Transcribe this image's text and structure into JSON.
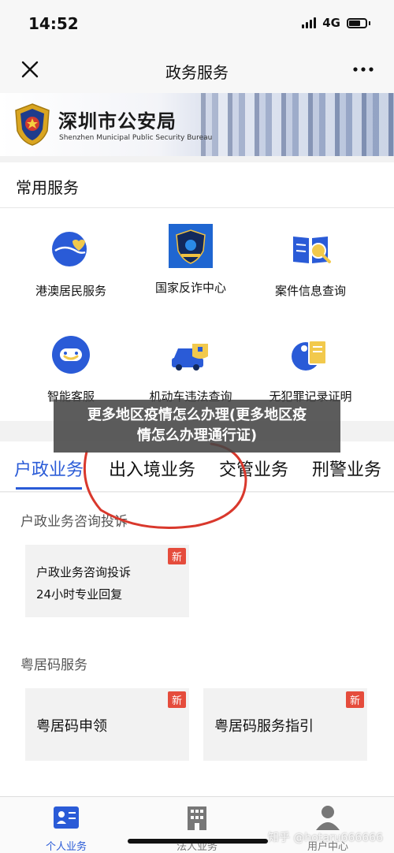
{
  "status_bar": {
    "time": "14:52",
    "network": "4G"
  },
  "nav": {
    "title": "政务服务"
  },
  "banner": {
    "name_cn": "深圳市公安局",
    "name_en": "Shenzhen Municipal Public Security Bureau"
  },
  "common_services": {
    "title": "常用服务",
    "items": [
      {
        "label": "港澳居民服务",
        "icon": "globe-heart-icon"
      },
      {
        "label": "国家反诈中心",
        "icon": "anti-fraud-badge-icon"
      },
      {
        "label": "案件信息查询",
        "icon": "case-search-icon"
      },
      {
        "label": "智能客服",
        "icon": "customer-service-icon"
      },
      {
        "label": "机动车违法查询",
        "icon": "vehicle-violation-icon"
      },
      {
        "label": "无犯罪记录证明",
        "icon": "record-certificate-icon"
      }
    ]
  },
  "overlay": {
    "line1": "更多地区疫情怎么办理(更多地区疫",
    "line2": "情怎么办理通行证)"
  },
  "tabs": [
    "户政业务",
    "出入境业务",
    "交管业务",
    "刑警业务"
  ],
  "groups": {
    "hz": {
      "title": "户政业务咨询投诉",
      "card": {
        "badge": "新",
        "line1": "户政业务咨询投诉",
        "line2": "24小时专业回复"
      }
    },
    "yjm": {
      "title": "粤居码服务",
      "cards": [
        {
          "badge": "新",
          "label": "粤居码申领"
        },
        {
          "badge": "新",
          "label": "粤居码服务指引"
        }
      ]
    }
  },
  "bottom_nav": [
    {
      "label": "个人业务",
      "icon": "person-card-icon",
      "active": true
    },
    {
      "label": "法人业务",
      "icon": "building-icon",
      "active": false
    },
    {
      "label": "用户中心",
      "icon": "user-icon",
      "active": false
    }
  ],
  "watermark": "知乎 @hotaru666666",
  "colors": {
    "accent": "#2a5bd7",
    "badge": "#e54c3c",
    "annotation": "#d9382c"
  }
}
